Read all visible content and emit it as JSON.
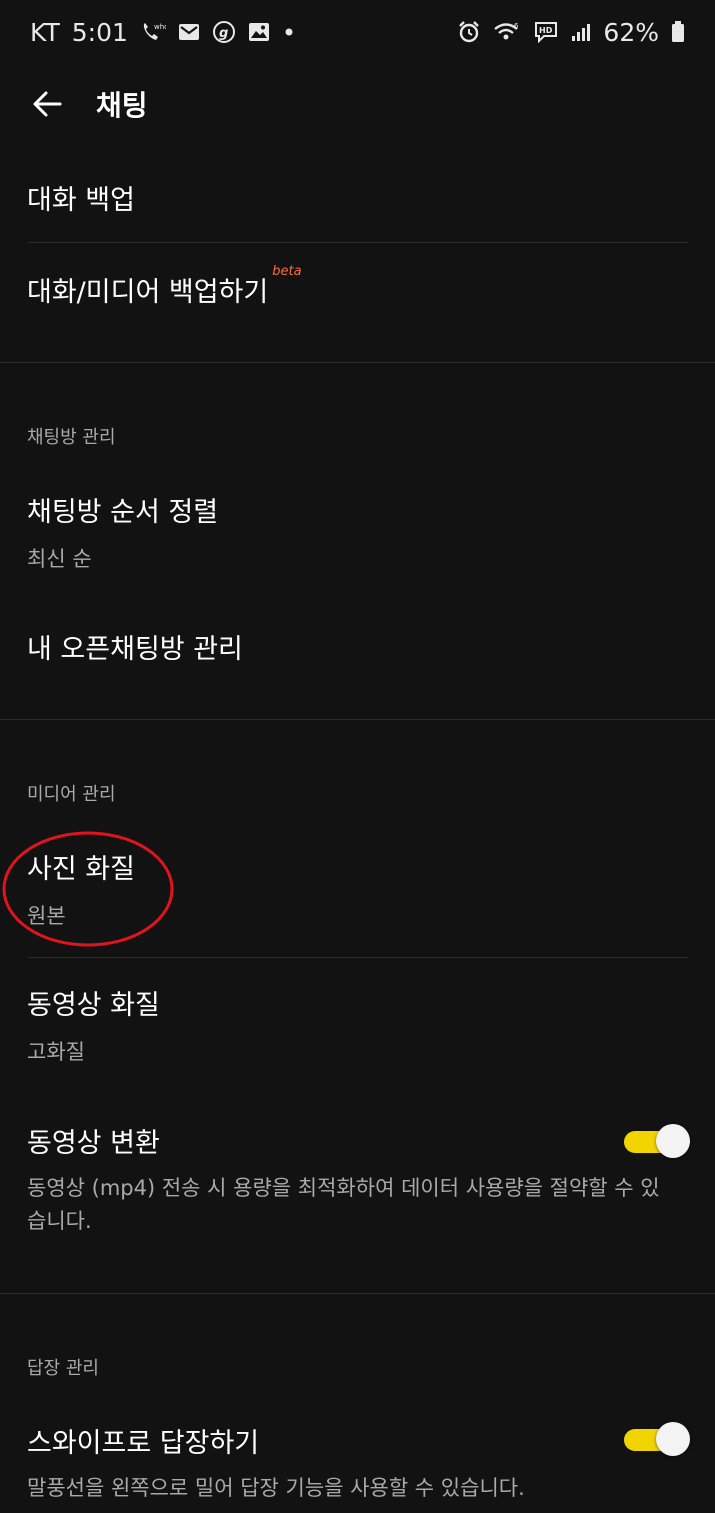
{
  "status_bar": {
    "carrier": "KT",
    "time": "5:01",
    "battery": "62%",
    "left_icons": [
      "whowho-call-icon",
      "gmail-icon",
      "g-app-icon",
      "gallery-icon",
      "dot-icon"
    ],
    "right_icons": [
      "alarm-icon",
      "wifi-icon",
      "hd-voice-icon",
      "signal-icon",
      "battery-icon"
    ]
  },
  "header": {
    "title": "채팅"
  },
  "backup": {
    "item1": "대화 백업",
    "item2": "대화/미디어 백업하기",
    "item2_badge": "beta"
  },
  "chatroom": {
    "section_label": "채팅방 관리",
    "sort_title": "채팅방 순서 정렬",
    "sort_value": "최신 순",
    "open_title": "내 오픈채팅방 관리"
  },
  "media": {
    "section_label": "미디어 관리",
    "photo_title": "사진 화질",
    "photo_value": "원본",
    "video_title": "동영상 화질",
    "video_value": "고화질",
    "convert_title": "동영상 변환",
    "convert_desc": "동영상 (mp4) 전송 시 용량을 최적화하여 데이터 사용량을 절약할 수 있습니다.",
    "convert_on": true
  },
  "reply": {
    "section_label": "답장 관리",
    "swipe_title": "스와이프로 답장하기",
    "swipe_desc": "말풍선을 왼쪽으로 밀어 답장 기능을 사용할 수 있습니다.",
    "swipe_on": true
  },
  "colors": {
    "background": "#121212",
    "toggle_on": "#f2d400",
    "beta": "#ff6a3d",
    "annotation": "#e0141e"
  }
}
